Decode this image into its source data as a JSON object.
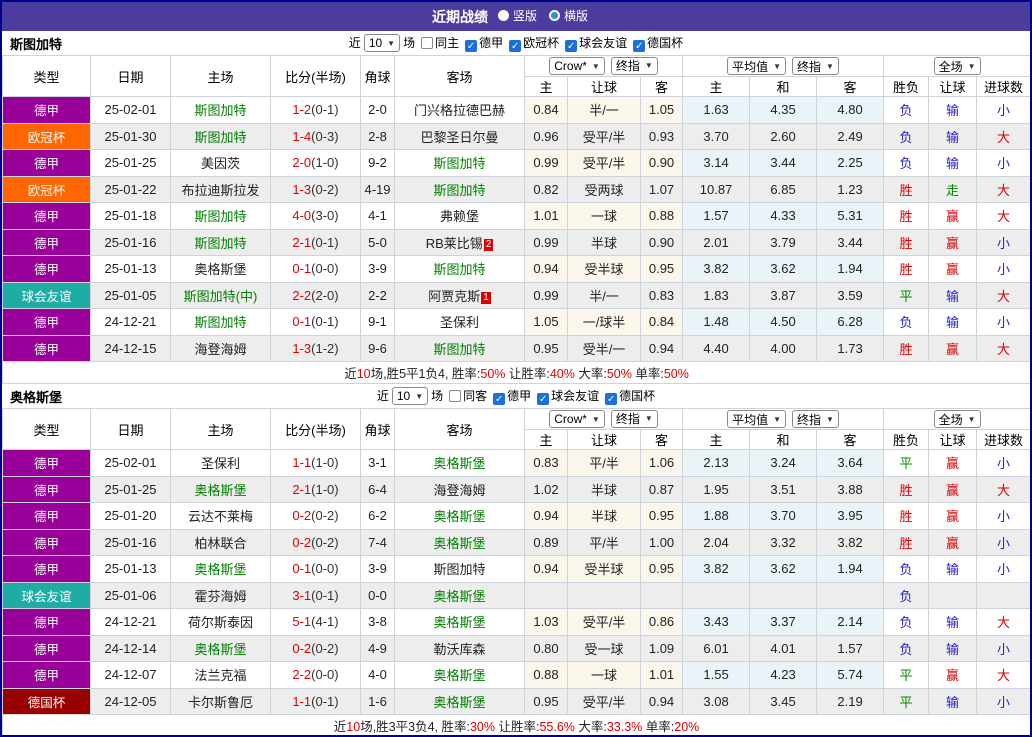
{
  "title_bar": {
    "title": "近期战绩",
    "options": [
      {
        "label": "竖版",
        "selected": true
      },
      {
        "label": "横版",
        "selected": false
      }
    ]
  },
  "colors": {
    "league": {
      "德甲": "#990099",
      "欧冠杯": "#ff6600",
      "球会友谊": "#1faca4",
      "德国杯": "#990000"
    },
    "result": {
      "胜": "#e00000",
      "平": "#008800",
      "负": "#2222cc",
      "赢": "#e00000",
      "走": "#008800",
      "输": "#2222cc",
      "大": "#e00000",
      "小": "#2222cc"
    },
    "team_highlight": "#008000",
    "score": "#e00000",
    "title_bg": "#4a3d9e",
    "odds_bg": "#fbf6ec",
    "avg_bg": "#e9f3f8",
    "row_alt_bg": "#ededed",
    "red_card_bg": "#e00000",
    "checkbox_checked": "#1c6fe0"
  },
  "columns": {
    "left": [
      "类型",
      "日期",
      "主场",
      "比分(半场)",
      "角球",
      "客场"
    ],
    "odds_sub": [
      "主",
      "让球",
      "客"
    ],
    "avg_sub": [
      "主",
      "和",
      "客"
    ],
    "result_sub": [
      "胜负",
      "让球",
      "进球数"
    ]
  },
  "dropdowns": {
    "odds": [
      "Crow*",
      "终指"
    ],
    "avg": [
      "平均值",
      "终指"
    ],
    "scope": [
      "全场"
    ]
  },
  "sections": [
    {
      "team": "斯图加特",
      "filter": {
        "prefix": "近",
        "count": "10",
        "suffix": "场",
        "same": {
          "label": "同主",
          "checked": false
        },
        "leagues": [
          {
            "label": "德甲",
            "checked": true
          },
          {
            "label": "欧冠杯",
            "checked": true
          },
          {
            "label": "球会友谊",
            "checked": true
          },
          {
            "label": "德国杯",
            "checked": true
          }
        ]
      },
      "rows": [
        {
          "league": "德甲",
          "date": "25-02-01",
          "home": "斯图加特",
          "home_self": true,
          "home_card": "",
          "score": "1-2",
          "half": "(0-1)",
          "corner": "2-0",
          "away": "门兴格拉德巴赫",
          "away_self": false,
          "away_card": "",
          "o_home": "0.84",
          "o_hcp": "半/一",
          "o_away": "1.05",
          "a_win": "1.63",
          "a_draw": "4.35",
          "a_lose": "4.80",
          "r_wl": "负",
          "r_hcp": "输",
          "r_goal": "小"
        },
        {
          "league": "欧冠杯",
          "date": "25-01-30",
          "home": "斯图加特",
          "home_self": true,
          "home_card": "",
          "score": "1-4",
          "half": "(0-3)",
          "corner": "2-8",
          "away": "巴黎圣日尔曼",
          "away_self": false,
          "away_card": "",
          "o_home": "0.96",
          "o_hcp": "受平/半",
          "o_away": "0.93",
          "a_win": "3.70",
          "a_draw": "2.60",
          "a_lose": "2.49",
          "r_wl": "负",
          "r_hcp": "输",
          "r_goal": "大"
        },
        {
          "league": "德甲",
          "date": "25-01-25",
          "home": "美因茨",
          "home_self": false,
          "home_card": "",
          "score": "2-0",
          "half": "(1-0)",
          "corner": "9-2",
          "away": "斯图加特",
          "away_self": true,
          "away_card": "",
          "o_home": "0.99",
          "o_hcp": "受平/半",
          "o_away": "0.90",
          "a_win": "3.14",
          "a_draw": "3.44",
          "a_lose": "2.25",
          "r_wl": "负",
          "r_hcp": "输",
          "r_goal": "小"
        },
        {
          "league": "欧冠杯",
          "date": "25-01-22",
          "home": "布拉迪斯拉发",
          "home_self": false,
          "home_card": "",
          "score": "1-3",
          "half": "(0-2)",
          "corner": "4-19",
          "away": "斯图加特",
          "away_self": true,
          "away_card": "",
          "o_home": "0.82",
          "o_hcp": "受两球",
          "o_away": "1.07",
          "a_win": "10.87",
          "a_draw": "6.85",
          "a_lose": "1.23",
          "r_wl": "胜",
          "r_hcp": "走",
          "r_goal": "大"
        },
        {
          "league": "德甲",
          "date": "25-01-18",
          "home": "斯图加特",
          "home_self": true,
          "home_card": "",
          "score": "4-0",
          "half": "(3-0)",
          "corner": "4-1",
          "away": "弗赖堡",
          "away_self": false,
          "away_card": "",
          "o_home": "1.01",
          "o_hcp": "一球",
          "o_away": "0.88",
          "a_win": "1.57",
          "a_draw": "4.33",
          "a_lose": "5.31",
          "r_wl": "胜",
          "r_hcp": "赢",
          "r_goal": "大"
        },
        {
          "league": "德甲",
          "date": "25-01-16",
          "home": "斯图加特",
          "home_self": true,
          "home_card": "",
          "score": "2-1",
          "half": "(0-1)",
          "corner": "5-0",
          "away": "RB莱比锡",
          "away_self": false,
          "away_card": "2",
          "o_home": "0.99",
          "o_hcp": "半球",
          "o_away": "0.90",
          "a_win": "2.01",
          "a_draw": "3.79",
          "a_lose": "3.44",
          "r_wl": "胜",
          "r_hcp": "赢",
          "r_goal": "小"
        },
        {
          "league": "德甲",
          "date": "25-01-13",
          "home": "奥格斯堡",
          "home_self": false,
          "home_card": "",
          "score": "0-1",
          "half": "(0-0)",
          "corner": "3-9",
          "away": "斯图加特",
          "away_self": true,
          "away_card": "",
          "o_home": "0.94",
          "o_hcp": "受半球",
          "o_away": "0.95",
          "a_win": "3.82",
          "a_draw": "3.62",
          "a_lose": "1.94",
          "r_wl": "胜",
          "r_hcp": "赢",
          "r_goal": "小"
        },
        {
          "league": "球会友谊",
          "date": "25-01-05",
          "home": "斯图加特(中)",
          "home_self": true,
          "home_card": "",
          "score": "2-2",
          "half": "(2-0)",
          "corner": "2-2",
          "away": "阿贾克斯",
          "away_self": false,
          "away_card": "1",
          "o_home": "0.99",
          "o_hcp": "半/一",
          "o_away": "0.83",
          "a_win": "1.83",
          "a_draw": "3.87",
          "a_lose": "3.59",
          "r_wl": "平",
          "r_hcp": "输",
          "r_goal": "大"
        },
        {
          "league": "德甲",
          "date": "24-12-21",
          "home": "斯图加特",
          "home_self": true,
          "home_card": "",
          "score": "0-1",
          "half": "(0-1)",
          "corner": "9-1",
          "away": "圣保利",
          "away_self": false,
          "away_card": "",
          "o_home": "1.05",
          "o_hcp": "一/球半",
          "o_away": "0.84",
          "a_win": "1.48",
          "a_draw": "4.50",
          "a_lose": "6.28",
          "r_wl": "负",
          "r_hcp": "输",
          "r_goal": "小"
        },
        {
          "league": "德甲",
          "date": "24-12-15",
          "home": "海登海姆",
          "home_self": false,
          "home_card": "",
          "score": "1-3",
          "half": "(1-2)",
          "corner": "9-6",
          "away": "斯图加特",
          "away_self": true,
          "away_card": "",
          "o_home": "0.95",
          "o_hcp": "受半/一",
          "o_away": "0.94",
          "a_win": "4.40",
          "a_draw": "4.00",
          "a_lose": "1.73",
          "r_wl": "胜",
          "r_hcp": "赢",
          "r_goal": "大"
        }
      ],
      "summary": [
        {
          "t": "近"
        },
        {
          "t": "10",
          "red": true
        },
        {
          "t": "场,胜5平1负4, 胜率:"
        },
        {
          "t": "50%",
          "red": true
        },
        {
          "t": " 让胜率:"
        },
        {
          "t": "40%",
          "red": true
        },
        {
          "t": " 大率:"
        },
        {
          "t": "50%",
          "red": true
        },
        {
          "t": " 单率:"
        },
        {
          "t": "50%",
          "red": true
        }
      ]
    },
    {
      "team": "奥格斯堡",
      "filter": {
        "prefix": "近",
        "count": "10",
        "suffix": "场",
        "same": {
          "label": "同客",
          "checked": false
        },
        "leagues": [
          {
            "label": "德甲",
            "checked": true
          },
          {
            "label": "球会友谊",
            "checked": true
          },
          {
            "label": "德国杯",
            "checked": true
          }
        ]
      },
      "rows": [
        {
          "league": "德甲",
          "date": "25-02-01",
          "home": "圣保利",
          "home_self": false,
          "home_card": "",
          "score": "1-1",
          "half": "(1-0)",
          "corner": "3-1",
          "away": "奥格斯堡",
          "away_self": true,
          "away_card": "",
          "o_home": "0.83",
          "o_hcp": "平/半",
          "o_away": "1.06",
          "a_win": "2.13",
          "a_draw": "3.24",
          "a_lose": "3.64",
          "r_wl": "平",
          "r_hcp": "赢",
          "r_goal": "小"
        },
        {
          "league": "德甲",
          "date": "25-01-25",
          "home": "奥格斯堡",
          "home_self": true,
          "home_card": "",
          "score": "2-1",
          "half": "(1-0)",
          "corner": "6-4",
          "away": "海登海姆",
          "away_self": false,
          "away_card": "",
          "o_home": "1.02",
          "o_hcp": "半球",
          "o_away": "0.87",
          "a_win": "1.95",
          "a_draw": "3.51",
          "a_lose": "3.88",
          "r_wl": "胜",
          "r_hcp": "赢",
          "r_goal": "大"
        },
        {
          "league": "德甲",
          "date": "25-01-20",
          "home": "云达不莱梅",
          "home_self": false,
          "home_card": "",
          "score": "0-2",
          "half": "(0-2)",
          "corner": "6-2",
          "away": "奥格斯堡",
          "away_self": true,
          "away_card": "",
          "o_home": "0.94",
          "o_hcp": "半球",
          "o_away": "0.95",
          "a_win": "1.88",
          "a_draw": "3.70",
          "a_lose": "3.95",
          "r_wl": "胜",
          "r_hcp": "赢",
          "r_goal": "小"
        },
        {
          "league": "德甲",
          "date": "25-01-16",
          "home": "柏林联合",
          "home_self": false,
          "home_card": "",
          "score": "0-2",
          "half": "(0-2)",
          "corner": "7-4",
          "away": "奥格斯堡",
          "away_self": true,
          "away_card": "",
          "o_home": "0.89",
          "o_hcp": "平/半",
          "o_away": "1.00",
          "a_win": "2.04",
          "a_draw": "3.32",
          "a_lose": "3.82",
          "r_wl": "胜",
          "r_hcp": "赢",
          "r_goal": "小"
        },
        {
          "league": "德甲",
          "date": "25-01-13",
          "home": "奥格斯堡",
          "home_self": true,
          "home_card": "",
          "score": "0-1",
          "half": "(0-0)",
          "corner": "3-9",
          "away": "斯图加特",
          "away_self": false,
          "away_card": "",
          "o_home": "0.94",
          "o_hcp": "受半球",
          "o_away": "0.95",
          "a_win": "3.82",
          "a_draw": "3.62",
          "a_lose": "1.94",
          "r_wl": "负",
          "r_hcp": "输",
          "r_goal": "小"
        },
        {
          "league": "球会友谊",
          "date": "25-01-06",
          "home": "霍芬海姆",
          "home_self": false,
          "home_card": "",
          "score": "3-1",
          "half": "(0-1)",
          "corner": "0-0",
          "away": "奥格斯堡",
          "away_self": true,
          "away_card": "",
          "o_home": "",
          "o_hcp": "",
          "o_away": "",
          "a_win": "",
          "a_draw": "",
          "a_lose": "",
          "r_wl": "负",
          "r_hcp": "",
          "r_goal": ""
        },
        {
          "league": "德甲",
          "date": "24-12-21",
          "home": "荷尔斯泰因",
          "home_self": false,
          "home_card": "",
          "score": "5-1",
          "half": "(4-1)",
          "corner": "3-8",
          "away": "奥格斯堡",
          "away_self": true,
          "away_card": "",
          "o_home": "1.03",
          "o_hcp": "受平/半",
          "o_away": "0.86",
          "a_win": "3.43",
          "a_draw": "3.37",
          "a_lose": "2.14",
          "r_wl": "负",
          "r_hcp": "输",
          "r_goal": "大"
        },
        {
          "league": "德甲",
          "date": "24-12-14",
          "home": "奥格斯堡",
          "home_self": true,
          "home_card": "",
          "score": "0-2",
          "half": "(0-2)",
          "corner": "4-9",
          "away": "勒沃库森",
          "away_self": false,
          "away_card": "",
          "o_home": "0.80",
          "o_hcp": "受一球",
          "o_away": "1.09",
          "a_win": "6.01",
          "a_draw": "4.01",
          "a_lose": "1.57",
          "r_wl": "负",
          "r_hcp": "输",
          "r_goal": "小"
        },
        {
          "league": "德甲",
          "date": "24-12-07",
          "home": "法兰克福",
          "home_self": false,
          "home_card": "",
          "score": "2-2",
          "half": "(0-0)",
          "corner": "4-0",
          "away": "奥格斯堡",
          "away_self": true,
          "away_card": "",
          "o_home": "0.88",
          "o_hcp": "一球",
          "o_away": "1.01",
          "a_win": "1.55",
          "a_draw": "4.23",
          "a_lose": "5.74",
          "r_wl": "平",
          "r_hcp": "赢",
          "r_goal": "大"
        },
        {
          "league": "德国杯",
          "date": "24-12-05",
          "home": "卡尔斯鲁厄",
          "home_self": false,
          "home_card": "",
          "score": "1-1",
          "half": "(0-1)",
          "corner": "1-6",
          "away": "奥格斯堡",
          "away_self": true,
          "away_card": "",
          "o_home": "0.95",
          "o_hcp": "受平/半",
          "o_away": "0.94",
          "a_win": "3.08",
          "a_draw": "3.45",
          "a_lose": "2.19",
          "r_wl": "平",
          "r_hcp": "输",
          "r_goal": "小"
        }
      ],
      "summary": [
        {
          "t": "近"
        },
        {
          "t": "10",
          "red": true
        },
        {
          "t": "场,胜3平3负4, 胜率:"
        },
        {
          "t": "30%",
          "red": true
        },
        {
          "t": " 让胜率:"
        },
        {
          "t": "55.6%",
          "red": true
        },
        {
          "t": " 大率:"
        },
        {
          "t": "33.3%",
          "red": true
        },
        {
          "t": " 单率:"
        },
        {
          "t": "20%",
          "red": true
        }
      ]
    }
  ]
}
